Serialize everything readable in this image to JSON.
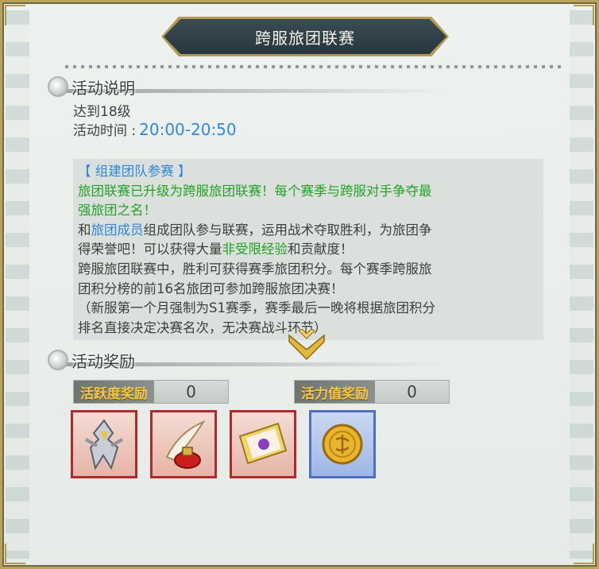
{
  "title": "跨服旅团联赛",
  "info": {
    "heading": "活动说明",
    "level_req": "达到18级",
    "time_label": "活动时间 :",
    "time_value": "20:00-20:50"
  },
  "description": {
    "l1": "【 组建团队参赛 】",
    "l2": "旅团联赛已升级为跨服旅团联赛！每个赛季与跨服对手争夺最",
    "l3": "强旅团之名！",
    "l4a": "和",
    "l4b": "旅团成员",
    "l4c": "组成团队参与联赛，运用战术夺取胜利，为旅团争",
    "l5a": "得荣誉吧！可以获得大量",
    "l5b": "非受限经验",
    "l5c": "和贡献度！",
    "l6": "跨服旅团联赛中，胜利可获得赛季旅团积分。每个赛季跨服旅",
    "l7": "团积分榜的前16名旅团可参加跨服旅团决赛！",
    "l8": "（新服第一个月强制为S1赛季，赛季最后一晚将根据旅团积分",
    "l9": "排名直接决定决赛名次，无决赛战斗环节）"
  },
  "rewards": {
    "heading": "活动奖励",
    "activity_label": "活跃度奖励",
    "activity_value": "0",
    "vitality_label": "活力值奖励",
    "vitality_value": "0"
  },
  "items": [
    {
      "icon": "mech-dragon-icon",
      "rarity_color": "#b3282b"
    },
    {
      "icon": "quill-ink-icon",
      "rarity_color": "#b3282b"
    },
    {
      "icon": "envelope-ticket-icon",
      "rarity_color": "#b3282b"
    },
    {
      "icon": "gold-coin-icon",
      "rarity_color": "#4f6fbf"
    }
  ],
  "colors": {
    "accent_blue": "#2e87d6",
    "accent_green": "#21a326",
    "gold_label": "#f2c64a",
    "frame_gold": "#b9a35a"
  }
}
